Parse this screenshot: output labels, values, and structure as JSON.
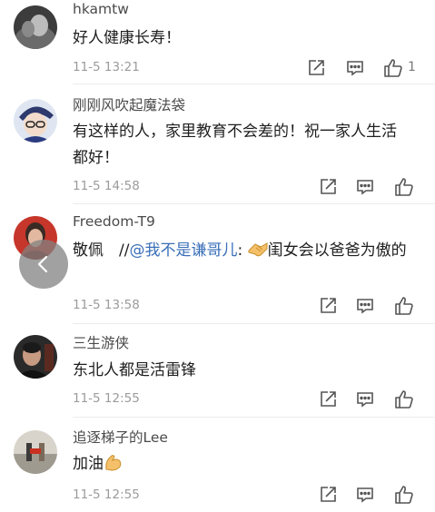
{
  "comments": [
    {
      "username": "hkamtw",
      "text": "好人健康长寿！",
      "timestamp": "11-5 13:21",
      "like_count": "1"
    },
    {
      "username": "刚刚风吹起魔法袋",
      "text": "有这样的人，家里教育不会差的！祝一家人生活都好！",
      "timestamp": "11-5 14:58",
      "like_count": ""
    },
    {
      "username": "Freedom-T9",
      "text_prefix": "敬佩　//",
      "mention": "@我不是谦哥儿",
      "text_suffix_1": ": ",
      "text_suffix_2": "闺女会以爸爸为傲的",
      "timestamp": "11-5 13:58",
      "like_count": ""
    },
    {
      "username": "三生游侠",
      "text": "东北人都是活雷锋",
      "timestamp": "11-5 12:55",
      "like_count": ""
    },
    {
      "username": "追逐梯子的Lee",
      "text": "加油",
      "timestamp": "11-5 12:55",
      "like_count": ""
    }
  ],
  "icons": {
    "share": "share-icon",
    "comment": "comment-icon",
    "like": "thumbs-up-icon",
    "back": "chevron-left-icon",
    "handshake": "handshake-emoji-icon",
    "muscle": "flexed-biceps-emoji-icon"
  },
  "colors": {
    "mention": "#3a6fb8",
    "timestamp": "#9b9b9b",
    "divider": "#ececec"
  }
}
